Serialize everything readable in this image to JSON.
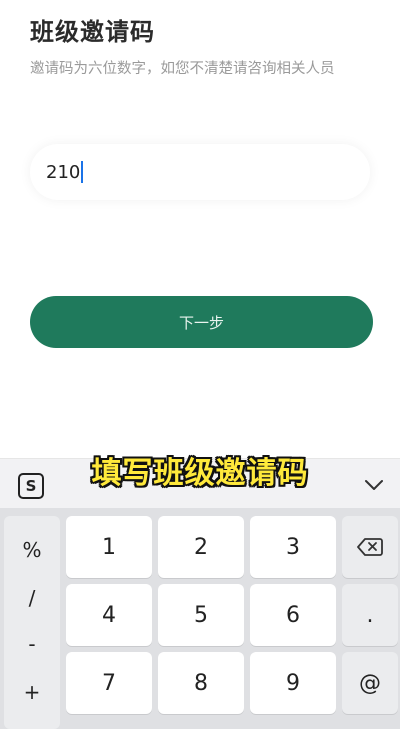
{
  "page": {
    "title": "班级邀请码",
    "hint": "邀请码为六位数字，如您不清楚请咨询相关人员"
  },
  "code_field": {
    "value": "210"
  },
  "next_button": {
    "label": "下一步"
  },
  "caption": "填写班级邀请码",
  "keyboard": {
    "ime_logo": "S",
    "symbols": [
      "%",
      "/",
      "-",
      "+"
    ],
    "digits": [
      "1",
      "2",
      "3",
      "4",
      "5",
      "6",
      "7",
      "8",
      "9"
    ],
    "right_keys": {
      "dot": ".",
      "at": "@"
    }
  },
  "colors": {
    "primary_button": "#1f7a5c",
    "caption": "#ffe93b",
    "cursor": "#1a73e8"
  }
}
